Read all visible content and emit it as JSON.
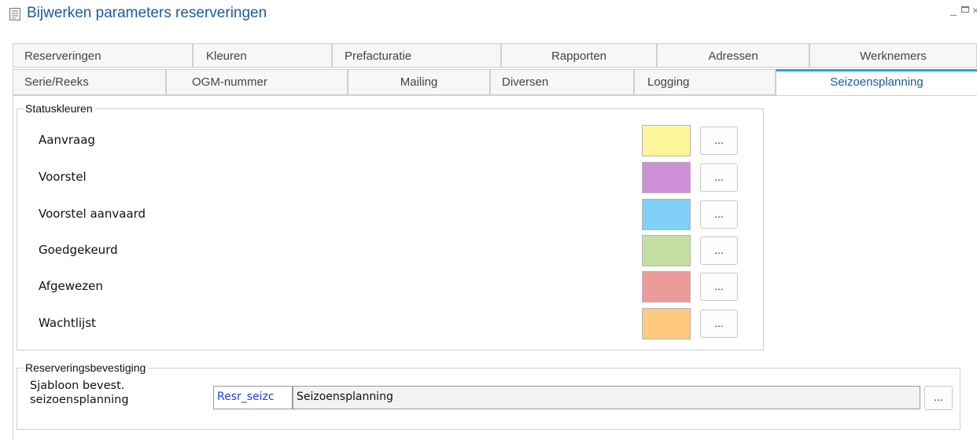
{
  "window": {
    "title": "Bijwerken parameters reserveringen",
    "minimize_glyph": "_",
    "close_glyph": "×"
  },
  "tabs_row1": [
    "Reserveringen",
    "Kleuren",
    "Prefacturatie",
    "Rapporten",
    "Adressen",
    "Werknemers"
  ],
  "tabs_row2": [
    "Serie/Reeks",
    "OGM-nummer",
    "Mailing",
    "Diversen",
    "Logging",
    "Seizoensplanning"
  ],
  "active_tab": "Seizoensplanning",
  "statuskleuren": {
    "legend": "Statuskleuren",
    "button_label": "...",
    "items": [
      {
        "label": "Aanvraag",
        "color": "#FFF59A"
      },
      {
        "label": "Voorstel",
        "color": "#CF8FD8"
      },
      {
        "label": "Voorstel aanvaard",
        "color": "#80D0F8"
      },
      {
        "label": "Goedgekeurd",
        "color": "#C4DFA2"
      },
      {
        "label": "Afgewezen",
        "color": "#EC9A9A"
      },
      {
        "label": "Wachtlijst",
        "color": "#FFCA80"
      }
    ]
  },
  "bevestiging": {
    "legend": "Reserveringsbevestiging",
    "label_line1": "Sjabloon bevest.",
    "label_line2": "seizoensplanning",
    "code_value": "Resr_seizc",
    "name_value": "Seizoensplanning",
    "button_label": "..."
  },
  "colors": {
    "title": "#1E5AA0",
    "active_tab_accent": "#2B9FE0"
  }
}
